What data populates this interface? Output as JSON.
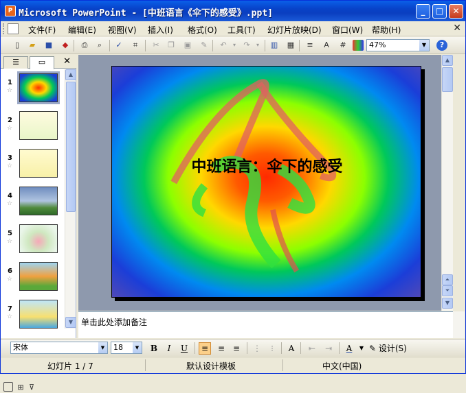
{
  "window": {
    "icon_text": "P",
    "title": "Microsoft PowerPoint - [中班语言《伞下的感受》.ppt]",
    "min": "_",
    "max": "□",
    "close": "✕"
  },
  "menubar": {
    "items": [
      "文件(F)",
      "编辑(E)",
      "视图(V)",
      "插入(I)",
      "格式(O)",
      "工具(T)",
      "幻灯片放映(D)",
      "窗口(W)",
      "帮助(H)"
    ],
    "close": "✕"
  },
  "toolbar": {
    "zoom": "47%",
    "help": "?"
  },
  "panel": {
    "tab_outline": "☰",
    "tab_slides": "▭",
    "close": "✕",
    "thumbnails": [
      {
        "num": "1",
        "star": "☆"
      },
      {
        "num": "2",
        "star": "☆"
      },
      {
        "num": "3",
        "star": "☆"
      },
      {
        "num": "4",
        "star": "☆"
      },
      {
        "num": "5",
        "star": "☆"
      },
      {
        "num": "6",
        "star": "☆"
      },
      {
        "num": "7",
        "star": "☆"
      }
    ]
  },
  "slide": {
    "title": "中班语言：伞下的感受"
  },
  "notes": {
    "placeholder": "单击此处添加备注"
  },
  "format": {
    "font": "宋体",
    "size": "18",
    "bold": "B",
    "italic": "I",
    "underline": "U",
    "font_color": "A",
    "design": "设计(S)"
  },
  "status": {
    "slide": "幻灯片 1 / 7",
    "template": "默认设计模板",
    "language": "中文(中国)"
  }
}
